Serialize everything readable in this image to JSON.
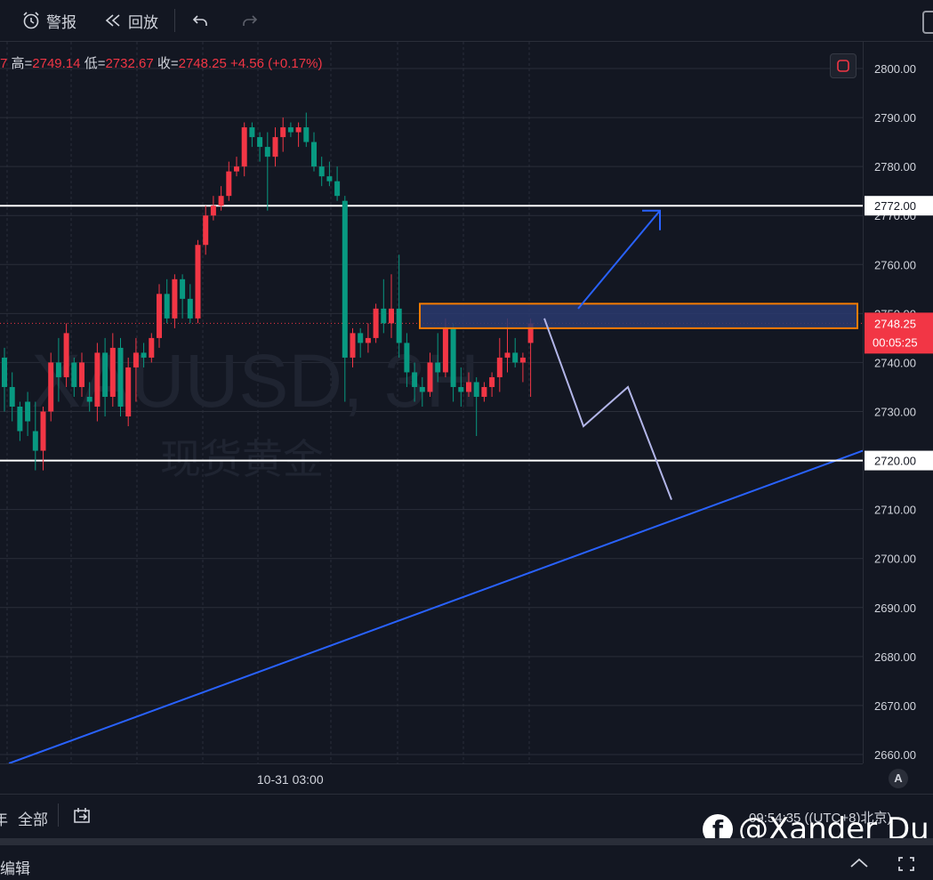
{
  "toolbar": {
    "alert_label": "警报",
    "replay_label": "回放"
  },
  "ohlc": {
    "open_fragment": "7",
    "high_label": "高=",
    "high_value": "2749.14",
    "low_label": "低=",
    "low_value": "2732.67",
    "close_label": "收=",
    "close_value": "2748.25",
    "change": "+4.56 (+0.17%)"
  },
  "price_axis": {
    "current_price": "2748.25",
    "countdown": "00:05:25",
    "level_high_label": "2772.00",
    "level_low_label": "2720.00"
  },
  "time_axis": {
    "labels": [
      {
        "text": "10-31 03:00",
        "index": 37
      }
    ],
    "auto_label": "A"
  },
  "bottom_bar": {
    "all_label": "全部",
    "left_fragment": "年",
    "timezone": "09:54:35 ((UTC+8)北京)"
  },
  "footer": {
    "label": "编辑"
  },
  "watermark": {
    "symbol": "XAUUSD, 3H",
    "name": "现货黄金",
    "credit": "@Xander Du"
  },
  "colors": {
    "bg": "#131722",
    "up": "#f23645",
    "down": "#089981",
    "grid": "#2a2e39",
    "trend": "#2962ff",
    "path": "#b2b5e8",
    "zone_border": "#f57c00",
    "zone_fill": "#2a3a6e"
  },
  "chart_data": {
    "type": "candlestick",
    "symbol": "XAUUSD",
    "ylim": [
      2655,
      2803
    ],
    "yticks": [
      2660,
      2670,
      2680,
      2690,
      2700,
      2710,
      2720,
      2730,
      2740,
      2750,
      2760,
      2770,
      2780,
      2790,
      2800
    ],
    "candles": [
      [
        2741,
        2743,
        2730,
        2735
      ],
      [
        2735,
        2738,
        2728,
        2731
      ],
      [
        2731,
        2732,
        2724,
        2726
      ],
      [
        2732,
        2734,
        2725,
        2728
      ],
      [
        2726,
        2732,
        2718,
        2722
      ],
      [
        2722,
        2731,
        2718,
        2730
      ],
      [
        2730,
        2742,
        2728,
        2740
      ],
      [
        2740,
        2745,
        2732,
        2737
      ],
      [
        2737,
        2748,
        2735,
        2746
      ],
      [
        2740,
        2741,
        2733,
        2735
      ],
      [
        2735,
        2742,
        2733,
        2740
      ],
      [
        2733,
        2736,
        2730,
        2732
      ],
      [
        2731,
        2744,
        2728,
        2742
      ],
      [
        2742,
        2745,
        2729,
        2733
      ],
      [
        2733,
        2746,
        2731,
        2743
      ],
      [
        2743,
        2745,
        2729,
        2731
      ],
      [
        2729,
        2741,
        2727,
        2739
      ],
      [
        2739,
        2745,
        2732,
        2742
      ],
      [
        2742,
        2744,
        2739,
        2741
      ],
      [
        2741,
        2746,
        2740,
        2745
      ],
      [
        2745,
        2756,
        2743,
        2754
      ],
      [
        2754,
        2757,
        2748,
        2749
      ],
      [
        2749,
        2758,
        2747,
        2757
      ],
      [
        2757,
        2758,
        2749,
        2753
      ],
      [
        2753,
        2756,
        2748,
        2749
      ],
      [
        2749,
        2765,
        2748,
        2764
      ],
      [
        2764,
        2772,
        2762,
        2770
      ],
      [
        2770,
        2774,
        2769,
        2772
      ],
      [
        2772,
        2776,
        2771,
        2774
      ],
      [
        2774,
        2781,
        2773,
        2779
      ],
      [
        2779,
        2782,
        2778,
        2780
      ],
      [
        2780,
        2789,
        2778,
        2788
      ],
      [
        2788,
        2789,
        2784,
        2786
      ],
      [
        2786,
        2787,
        2781,
        2784
      ],
      [
        2784,
        2787,
        2771,
        2782
      ],
      [
        2782,
        2788,
        2780,
        2786
      ],
      [
        2786,
        2790,
        2783,
        2788
      ],
      [
        2788,
        2789,
        2786,
        2787
      ],
      [
        2787,
        2789,
        2784,
        2788
      ],
      [
        2788,
        2791,
        2784,
        2785
      ],
      [
        2785,
        2787,
        2779,
        2780
      ],
      [
        2780,
        2782,
        2776,
        2778
      ],
      [
        2778,
        2781,
        2776,
        2777
      ],
      [
        2777,
        2780,
        2773,
        2774
      ],
      [
        2773,
        2774,
        2732,
        2741
      ],
      [
        2741,
        2747,
        2739,
        2746
      ],
      [
        2746,
        2747,
        2741,
        2744
      ],
      [
        2744,
        2748,
        2742,
        2745
      ],
      [
        2745,
        2752,
        2744,
        2751
      ],
      [
        2751,
        2757,
        2746,
        2748
      ],
      [
        2748,
        2758,
        2745,
        2751
      ],
      [
        2751,
        2762,
        2741,
        2744
      ],
      [
        2744,
        2746,
        2735,
        2738
      ],
      [
        2738,
        2740,
        2732,
        2735
      ],
      [
        2735,
        2737,
        2731,
        2734
      ],
      [
        2734,
        2742,
        2733,
        2740
      ],
      [
        2740,
        2746,
        2736,
        2738
      ],
      [
        2738,
        2749,
        2737,
        2747
      ],
      [
        2747,
        2748,
        2732,
        2735
      ],
      [
        2735,
        2739,
        2731,
        2734
      ],
      [
        2734,
        2738,
        2733,
        2736
      ],
      [
        2736,
        2737,
        2725,
        2733
      ],
      [
        2733,
        2736,
        2732,
        2735
      ],
      [
        2735,
        2738,
        2733,
        2737
      ],
      [
        2737,
        2745,
        2734,
        2741
      ],
      [
        2741,
        2749,
        2738,
        2742
      ],
      [
        2742,
        2745,
        2739,
        2740
      ],
      [
        2740,
        2742,
        2736,
        2741
      ],
      [
        2744,
        2749,
        2733,
        2748
      ]
    ],
    "horizontal_levels": [
      2772,
      2720
    ],
    "zone": {
      "top": 2752,
      "bottom": 2747
    }
  }
}
